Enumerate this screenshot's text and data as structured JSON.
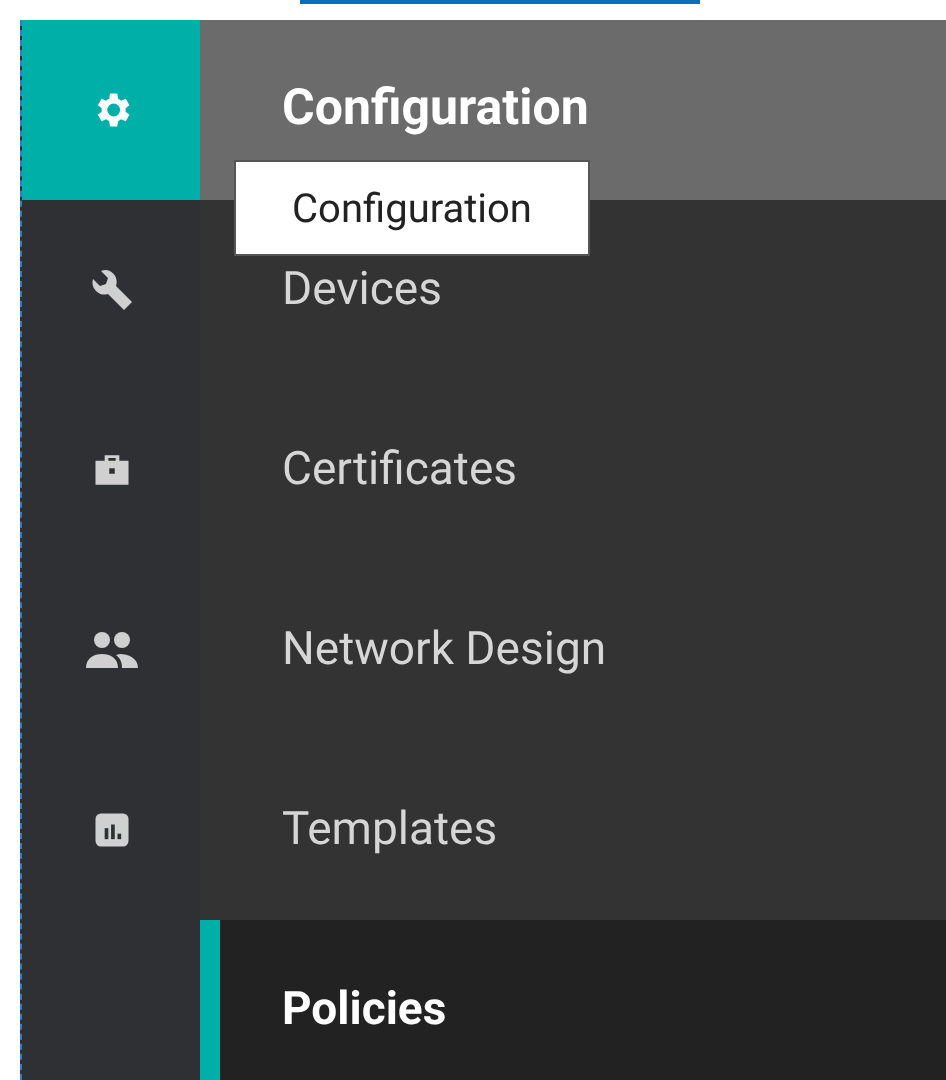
{
  "rail": [
    {
      "kind": "gear",
      "selected": true
    },
    {
      "kind": "wrench",
      "selected": false
    },
    {
      "kind": "briefcase",
      "selected": false
    },
    {
      "kind": "people",
      "selected": false
    },
    {
      "kind": "chart",
      "selected": false
    }
  ],
  "header": {
    "title": "Configuration"
  },
  "tooltip": {
    "text": "Configuration"
  },
  "menu": [
    {
      "label": "Devices",
      "selected": false
    },
    {
      "label": "Certificates",
      "selected": false
    },
    {
      "label": "Network Design",
      "selected": false
    },
    {
      "label": "Templates",
      "selected": false
    },
    {
      "label": "Policies",
      "selected": true
    }
  ]
}
